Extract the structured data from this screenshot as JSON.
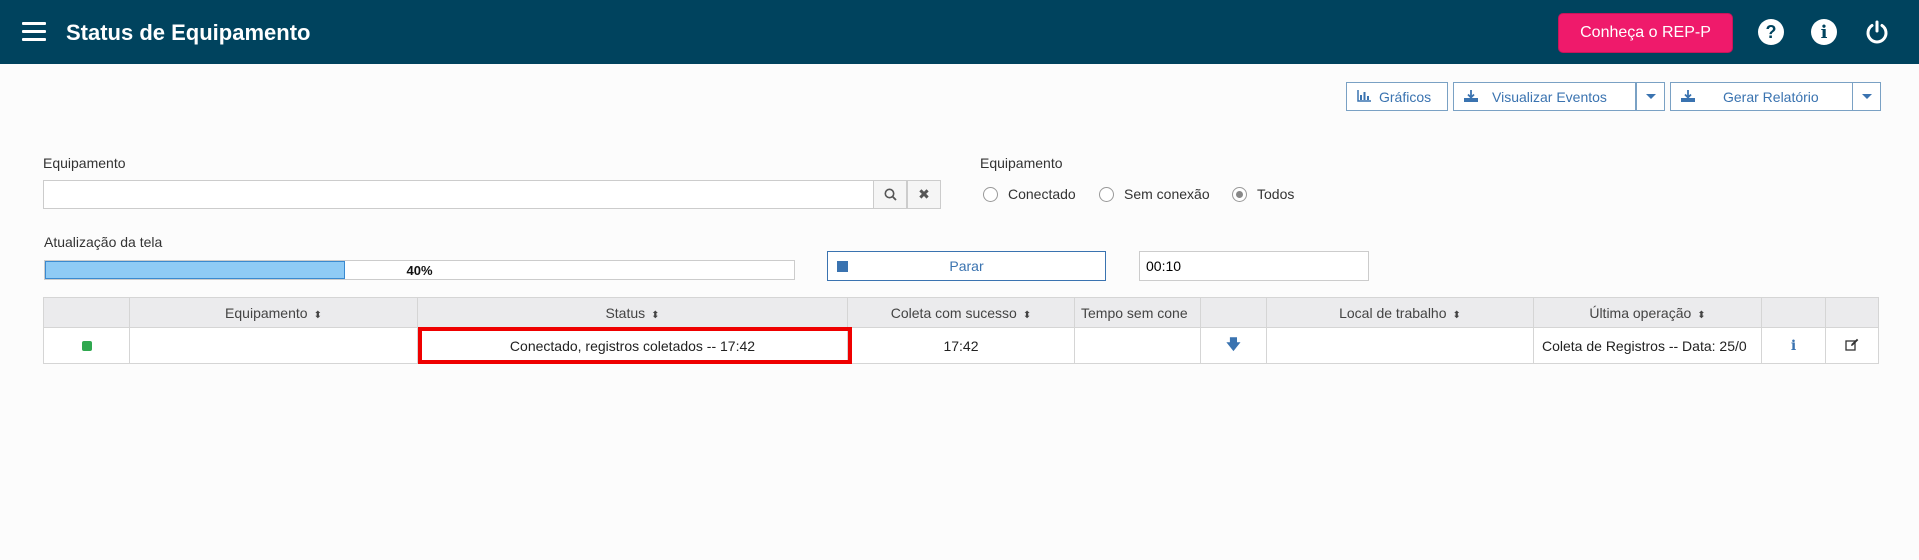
{
  "header": {
    "title": "Status de Equipamento",
    "rep_button": "Conheça o REP-P",
    "help": "?",
    "info": "i"
  },
  "toolbar": {
    "graficos": "Gráficos",
    "visualizar_eventos": "Visualizar Eventos",
    "gerar_relatorio": "Gerar Relatório"
  },
  "filters": {
    "equipamento_label": "Equipamento",
    "equipamento_value": "",
    "radio_group_label": "Equipamento",
    "radio_options": [
      "Conectado",
      "Sem conexão",
      "Todos"
    ],
    "selected": "Todos"
  },
  "refresh": {
    "label": "Atualização da tela",
    "progress_percent": 40,
    "progress_text": "40%",
    "stop_label": "Parar",
    "timer": "00:10"
  },
  "table": {
    "columns": [
      "Equipamento",
      "Status",
      "Coleta com sucesso",
      "Tempo sem cone",
      "Local de trabalho",
      "Última operação"
    ],
    "rows": [
      {
        "equipamento": "",
        "status": "Conectado, registros coletados -- 17:42",
        "coleta": "17:42",
        "tempo": "",
        "local": "",
        "ultima": "Coleta de Registros -- Data: 25/0"
      }
    ]
  },
  "colors": {
    "header_bg": "#00435e",
    "accent_pink": "#ef1a6b",
    "link_blue": "#3a73b0",
    "status_green": "#2fa84f",
    "highlight_red": "#ef0000"
  }
}
